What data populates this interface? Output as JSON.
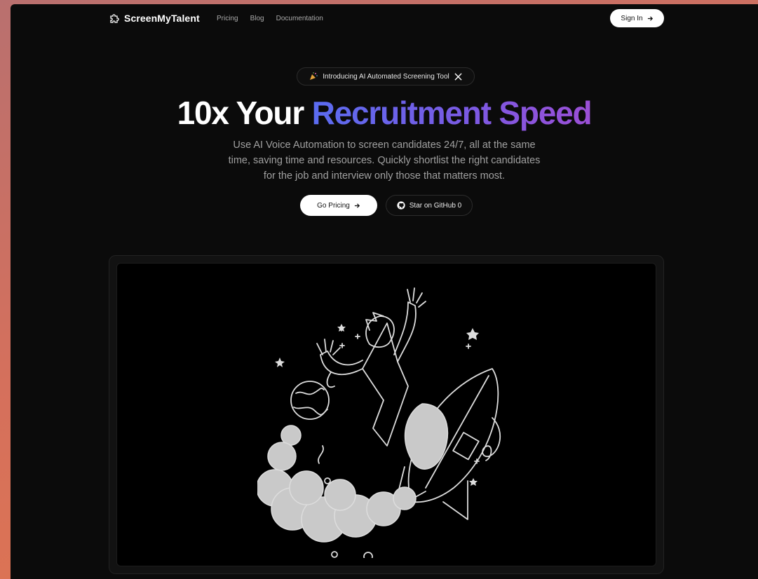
{
  "brand": {
    "name": "ScreenMyTalent",
    "logo_icon": "puzzle-logo-icon"
  },
  "nav": {
    "items": [
      "Pricing",
      "Blog",
      "Documentation"
    ]
  },
  "header": {
    "signin_label": "Sign In"
  },
  "announcement": {
    "label": "Introducing AI Automated Screening Tool",
    "icon_left": "party-popper-icon",
    "icon_right": "x-logo-icon"
  },
  "hero": {
    "headline_plain": "10x Your",
    "headline_highlight": "Recruitment Speed",
    "subtitle": "Use AI Voice Automation to screen candidates 24/7, all at the same time, saving time and resources. Quickly shortlist the right candidates for the job and interview only those that matters most."
  },
  "cta": {
    "primary_label": "Go Pricing",
    "secondary_label": "Star on GitHub 0"
  },
  "colors": {
    "gradient_start": "#5b6cf0",
    "gradient_end": "#9b4fd6",
    "background": "#0b0b0b"
  }
}
